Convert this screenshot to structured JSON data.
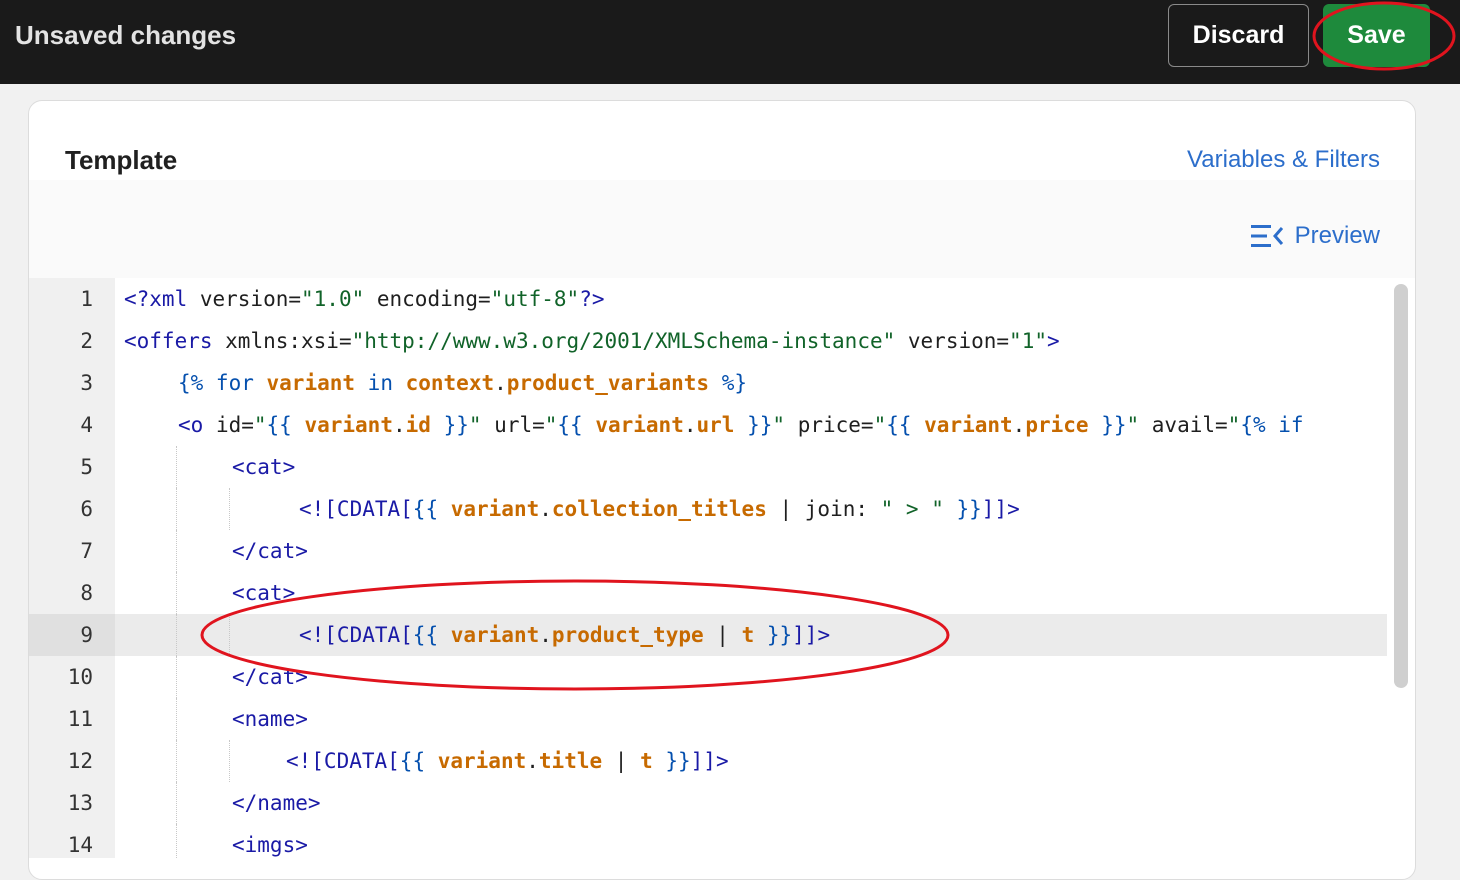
{
  "header": {
    "title": "Unsaved changes",
    "discard_label": "Discard",
    "save_label": "Save"
  },
  "card": {
    "title": "Template",
    "variables_link": "Variables & Filters",
    "preview_label": "Preview",
    "preview_icon": "collapse-lines-icon"
  },
  "editor": {
    "active_line": 9,
    "lines": [
      {
        "n": "1",
        "indent": 0,
        "tokens": [
          [
            "t-tag",
            "<?xml"
          ],
          [
            "t-attr",
            " version="
          ],
          [
            "t-str",
            "\"1.0\""
          ],
          [
            "t-attr",
            " encoding="
          ],
          [
            "t-str",
            "\"utf-8\""
          ],
          [
            "t-tag",
            "?>"
          ]
        ]
      },
      {
        "n": "2",
        "indent": 0,
        "tokens": [
          [
            "t-tag",
            "<offers"
          ],
          [
            "t-attr",
            " xmlns:xsi="
          ],
          [
            "t-str",
            "\"http://www.w3.org/2001/XMLSchema-instance\""
          ],
          [
            "t-attr",
            " version="
          ],
          [
            "t-str",
            "\"1\""
          ],
          [
            "t-tag",
            ">"
          ]
        ]
      },
      {
        "n": "3",
        "indent": 1,
        "tokens": [
          [
            "t-liq",
            "{% for "
          ],
          [
            "t-var",
            "variant"
          ],
          [
            "t-liq",
            " in "
          ],
          [
            "t-var",
            "context"
          ],
          [
            "t-dot",
            "."
          ],
          [
            "t-var",
            "product_variants"
          ],
          [
            "t-liq",
            " %}"
          ]
        ]
      },
      {
        "n": "4",
        "indent": 1,
        "tokens": [
          [
            "t-tag",
            "<o"
          ],
          [
            "t-attr",
            " id="
          ],
          [
            "t-str",
            "\""
          ],
          [
            "t-liq",
            "{{ "
          ],
          [
            "t-var",
            "variant"
          ],
          [
            "t-dot",
            "."
          ],
          [
            "t-var",
            "id"
          ],
          [
            "t-liq",
            " }}"
          ],
          [
            "t-str",
            "\""
          ],
          [
            "t-attr",
            " url="
          ],
          [
            "t-str",
            "\""
          ],
          [
            "t-liq",
            "{{ "
          ],
          [
            "t-var",
            "variant"
          ],
          [
            "t-dot",
            "."
          ],
          [
            "t-var",
            "url"
          ],
          [
            "t-liq",
            " }}"
          ],
          [
            "t-str",
            "\""
          ],
          [
            "t-attr",
            " price="
          ],
          [
            "t-str",
            "\""
          ],
          [
            "t-liq",
            "{{ "
          ],
          [
            "t-var",
            "variant"
          ],
          [
            "t-dot",
            "."
          ],
          [
            "t-var",
            "price"
          ],
          [
            "t-liq",
            " }}"
          ],
          [
            "t-str",
            "\""
          ],
          [
            "t-attr",
            " avail="
          ],
          [
            "t-str",
            "\""
          ],
          [
            "t-liq",
            "{% if"
          ]
        ]
      },
      {
        "n": "5",
        "indent": 2,
        "tokens": [
          [
            "t-tag",
            "<cat>"
          ]
        ]
      },
      {
        "n": "6",
        "indent": 3,
        "tokens": [
          [
            "t-tag",
            "<![CDATA["
          ],
          [
            "t-liq",
            "{{ "
          ],
          [
            "t-var",
            "variant"
          ],
          [
            "t-dot",
            "."
          ],
          [
            "t-var",
            "collection_titles"
          ],
          [
            "t-pipe",
            " | "
          ],
          [
            "t-plain",
            "join: "
          ],
          [
            "t-str",
            "\" > \""
          ],
          [
            "t-liq",
            " }}"
          ],
          [
            "t-tag",
            "]]>"
          ]
        ]
      },
      {
        "n": "7",
        "indent": 2,
        "tokens": [
          [
            "t-tag",
            "</cat>"
          ]
        ]
      },
      {
        "n": "8",
        "indent": 2,
        "tokens": [
          [
            "t-tag",
            "<cat>"
          ]
        ]
      },
      {
        "n": "9",
        "indent": 3,
        "tokens": [
          [
            "t-tag",
            "<![CDATA["
          ],
          [
            "t-liq",
            "{{ "
          ],
          [
            "t-var",
            "variant"
          ],
          [
            "t-dot",
            "."
          ],
          [
            "t-var",
            "product_type"
          ],
          [
            "t-pipe",
            " | "
          ],
          [
            "t-filter",
            "t"
          ],
          [
            "t-liq",
            " }}"
          ],
          [
            "t-tag",
            "]]>"
          ]
        ]
      },
      {
        "n": "10",
        "indent": 2,
        "tokens": [
          [
            "t-tag",
            "</cat>"
          ]
        ]
      },
      {
        "n": "11",
        "indent": 2,
        "tokens": [
          [
            "t-tag",
            "<name>"
          ]
        ]
      },
      {
        "n": "12",
        "indent": 3,
        "tokens": [
          [
            "t-tag",
            "<![CDATA["
          ],
          [
            "t-liq",
            "{{ "
          ],
          [
            "t-var",
            "variant"
          ],
          [
            "t-dot",
            "."
          ],
          [
            "t-var",
            "title"
          ],
          [
            "t-pipe",
            " | "
          ],
          [
            "t-filter",
            "t"
          ],
          [
            "t-liq",
            " }}"
          ],
          [
            "t-tag",
            "]]>"
          ]
        ]
      },
      {
        "n": "13",
        "indent": 2,
        "tokens": [
          [
            "t-tag",
            "</name>"
          ]
        ]
      },
      {
        "n": "14",
        "indent": 2,
        "tokens": [
          [
            "t-tag",
            "<imgs>"
          ]
        ]
      }
    ]
  },
  "colors": {
    "accent_link": "#2c6ecb",
    "save_green": "#1e8a3c",
    "annotation_red": "#e0141e"
  }
}
